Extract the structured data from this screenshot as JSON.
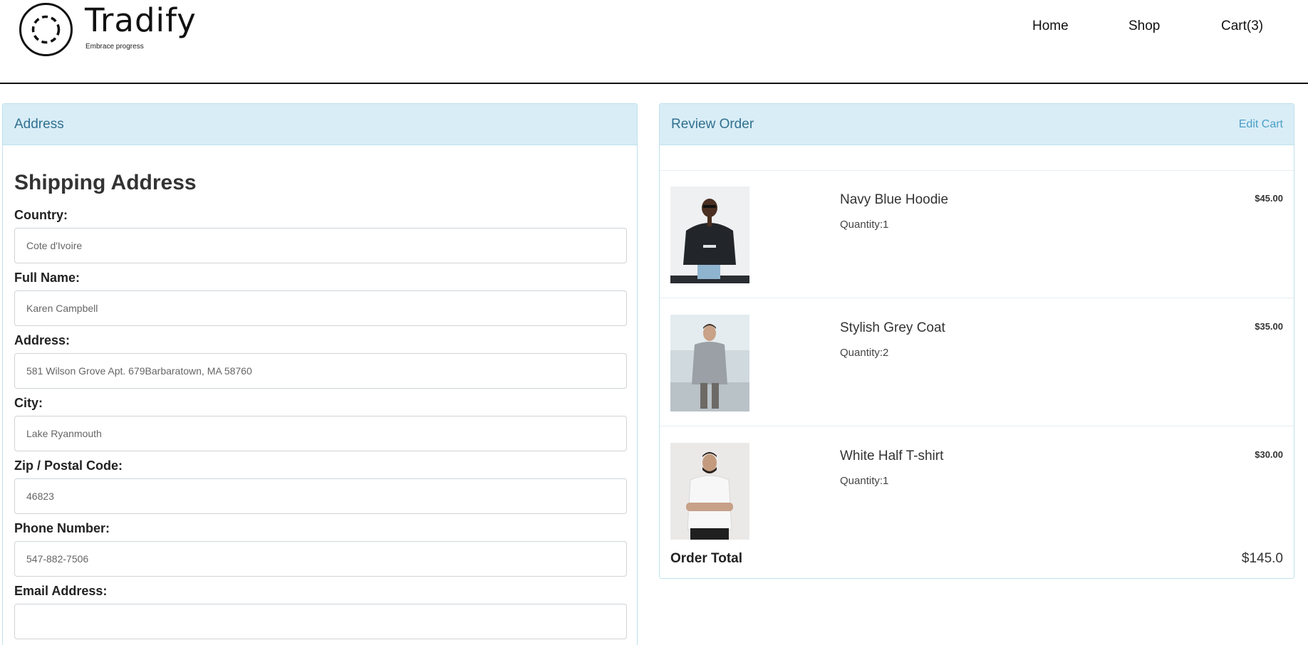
{
  "brand": {
    "name": "Tradify",
    "tagline": "Embrace progress"
  },
  "nav": {
    "home": "Home",
    "shop": "Shop",
    "cart": "Cart(3)"
  },
  "address_card": {
    "header": "Address",
    "title": "Shipping Address",
    "fields": [
      {
        "label": "Country:",
        "placeholder": "Cote d'Ivoire"
      },
      {
        "label": "Full Name:",
        "placeholder": "Karen Campbell"
      },
      {
        "label": "Address:",
        "placeholder": "581 Wilson Grove Apt. 679Barbaratown, MA 58760"
      },
      {
        "label": "City:",
        "placeholder": "Lake Ryanmouth"
      },
      {
        "label": "Zip / Postal Code:",
        "placeholder": "46823"
      },
      {
        "label": "Phone Number:",
        "placeholder": "547-882-7506"
      },
      {
        "label": "Email Address:",
        "placeholder": ""
      }
    ]
  },
  "review_card": {
    "header": "Review Order",
    "edit_cart": "Edit Cart",
    "quantity_prefix": "Quantity:",
    "items": [
      {
        "name": "Navy Blue Hoodie",
        "quantity": "1",
        "price": "$45.00"
      },
      {
        "name": "Stylish Grey Coat",
        "quantity": "2",
        "price": "$35.00"
      },
      {
        "name": "White Half T-shirt",
        "quantity": "1",
        "price": "$30.00"
      }
    ],
    "total_label": "Order Total",
    "total_value": "$145.0"
  },
  "colors": {
    "card_header_bg": "#d9edf7",
    "card_header_text": "#31708f",
    "link": "#4a9fc6"
  }
}
